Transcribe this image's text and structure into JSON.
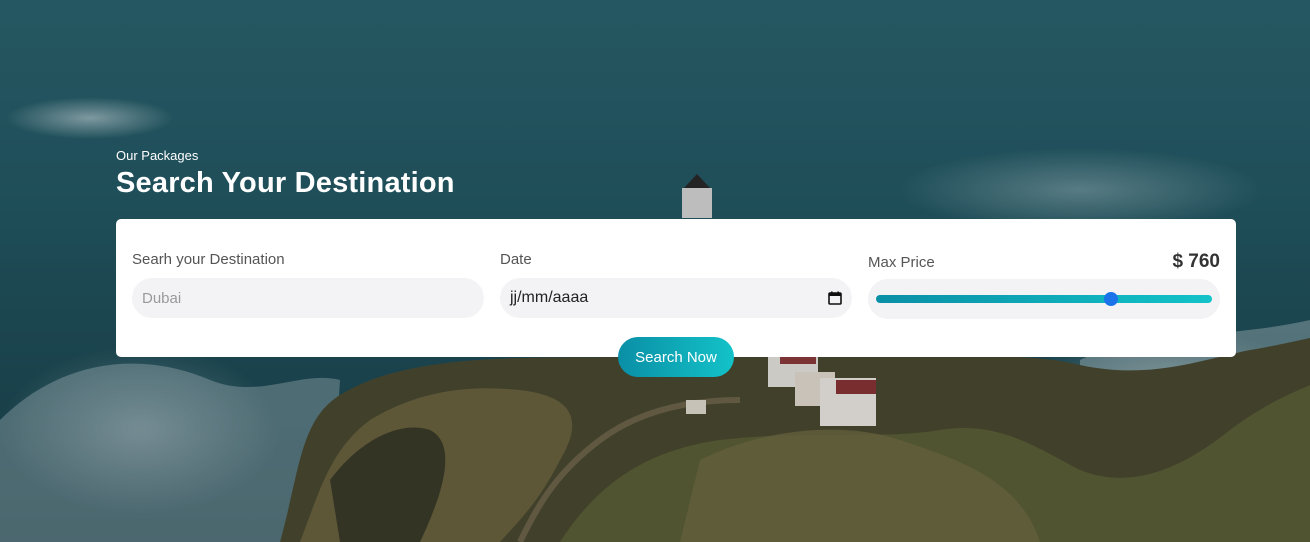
{
  "hero": {
    "eyebrow": "Our Packages",
    "title": "Search Your Destination"
  },
  "search": {
    "destination": {
      "label": "Searh your Destination",
      "placeholder": "Dubai",
      "value": ""
    },
    "date": {
      "label": "Date",
      "value": "jj/mm/aaaa",
      "icon": "calendar-icon"
    },
    "price": {
      "label": "Max Price",
      "display": "$ 760",
      "value_fraction": 0.7
    },
    "button_label": "Search Now"
  },
  "colors": {
    "accent_start": "#0a8fa6",
    "accent_end": "#13c2c8",
    "slider_thumb": "#1a73e8"
  }
}
